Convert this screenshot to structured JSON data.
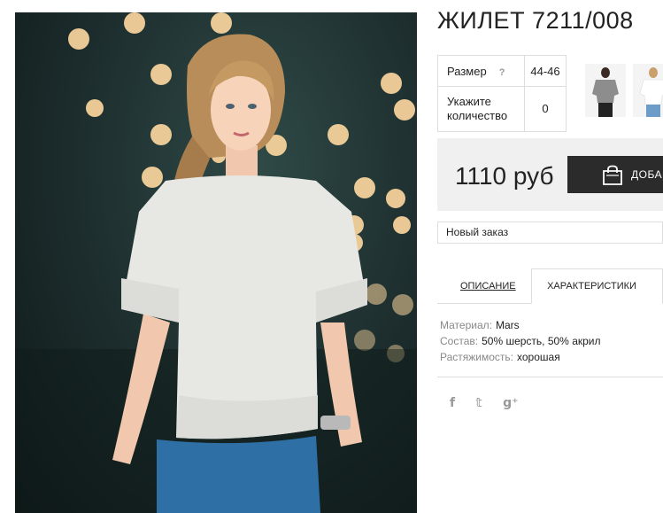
{
  "product": {
    "title": "ЖИЛЕТ 7211/008",
    "image_alt": "model wearing white knitted short-sleeve top and blue jeans"
  },
  "options": {
    "size_label": "Размер",
    "size_help": "?",
    "size_value": "44-46",
    "qty_label_line1": "Укажите",
    "qty_label_line2": "количество",
    "qty_value": "0"
  },
  "thumbnails": [
    {
      "name": "thumb-gray-top"
    },
    {
      "name": "thumb-white-top"
    }
  ],
  "purchase": {
    "price": "1110 руб",
    "cart_label": "ДОБАВ",
    "cart_icon": "shopping-bag-icon"
  },
  "order_select": {
    "value": "Новый заказ"
  },
  "tabs": [
    {
      "label": "ОПИСАНИЕ",
      "active": false
    },
    {
      "label": "ХАРАКТЕРИСТИКИ",
      "active": true
    }
  ],
  "properties": [
    {
      "key": "Материал:",
      "value": "Mars"
    },
    {
      "key": "Состав:",
      "value": "50% шерсть, 50% акрил"
    },
    {
      "key": "Растяжимость:",
      "value": "хорошая"
    }
  ],
  "social": [
    {
      "icon": "facebook-icon",
      "glyph": "f"
    },
    {
      "icon": "twitter-icon",
      "glyph": "𝕥"
    },
    {
      "icon": "google-plus-icon",
      "glyph": "g⁺"
    }
  ],
  "colors": {
    "button_bg": "#2b2b2b",
    "price_panel_bg": "#f0f0f0",
    "border": "#dddddd"
  }
}
